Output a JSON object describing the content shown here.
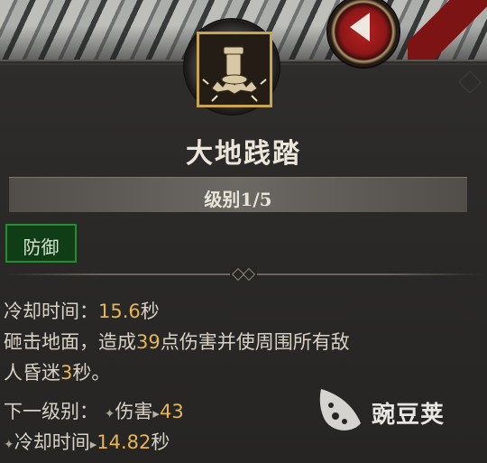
{
  "skill": {
    "name": "大地践踏",
    "level_label": "级别1/5",
    "tag": "防御"
  },
  "stats": {
    "cooldown_label": "冷却时间：",
    "cooldown_value": "15.6",
    "cooldown_unit": "秒"
  },
  "description": {
    "line1_pre": "砸击地面，造成",
    "line1_num": "39",
    "line1_post": "点伤害并使周围所有敌",
    "line2_pre": "人昏迷",
    "line2_num": "3",
    "line2_post": "秒。"
  },
  "next_level": {
    "label": "下一级别：",
    "bullet": "✦",
    "arrow": "▸",
    "damage_label": "伤害",
    "damage_value": "43",
    "cooldown_label": "冷却时间",
    "cooldown_value": "14.82",
    "cooldown_unit": "秒"
  },
  "watermark": {
    "text": "豌豆荚"
  },
  "icons": {
    "skill": "stomp-boot-icon",
    "back": "back-arrow-icon",
    "watermark_logo": "pea-pod-logo"
  },
  "colors": {
    "accent_gold": "#e5b558",
    "tag_green": "#0f3d15",
    "back_red": "#b32222"
  }
}
